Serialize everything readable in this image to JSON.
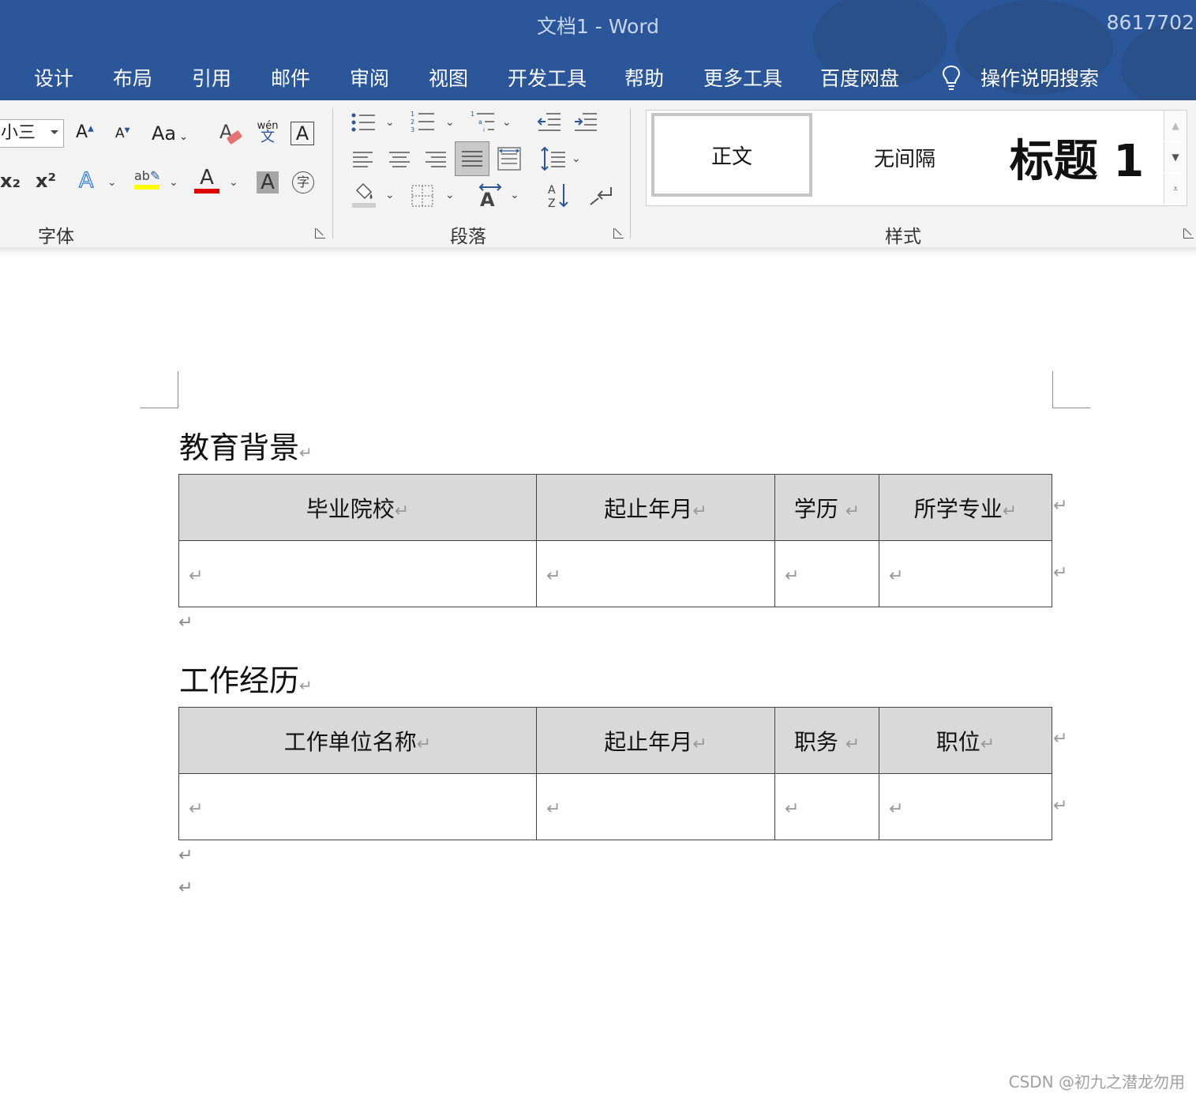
{
  "window": {
    "title": "文档1  -  Word",
    "account": "8617702"
  },
  "menu": {
    "items": [
      "设计",
      "布局",
      "引用",
      "邮件",
      "审阅",
      "视图",
      "开发工具",
      "帮助",
      "更多工具",
      "百度网盘"
    ],
    "search_label": "操作说明搜索"
  },
  "ribbon": {
    "font_group": {
      "label": "字体",
      "font_size": "小三",
      "change_case": "Aa",
      "phonetic_top": "wén",
      "phonetic_bottom": "文",
      "char_border": "A",
      "enclose_char": "字",
      "subscript": "x₂",
      "superscript": "x²"
    },
    "paragraph_group": {
      "label": "段落"
    },
    "styles_group": {
      "label": "样式",
      "styles": [
        "正文",
        "无间隔",
        "标题 1"
      ]
    }
  },
  "document": {
    "sections": [
      {
        "heading": "教育背景",
        "columns": [
          "毕业院校",
          "起止年月",
          "学历 ",
          "所学专业"
        ],
        "rows": [
          [
            "",
            "",
            "",
            ""
          ]
        ]
      },
      {
        "heading": "工作经历",
        "columns": [
          "工作单位名称",
          "起止年月",
          "职务 ",
          "职位"
        ],
        "rows": [
          [
            "",
            "",
            "",
            ""
          ]
        ]
      }
    ],
    "paragraph_mark": "↵"
  },
  "watermark": "CSDN @初九之潜龙勿用",
  "colors": {
    "title_bar": "#2b579a",
    "ribbon": "#f3f3f3",
    "table_header": "#d9d9d9"
  }
}
